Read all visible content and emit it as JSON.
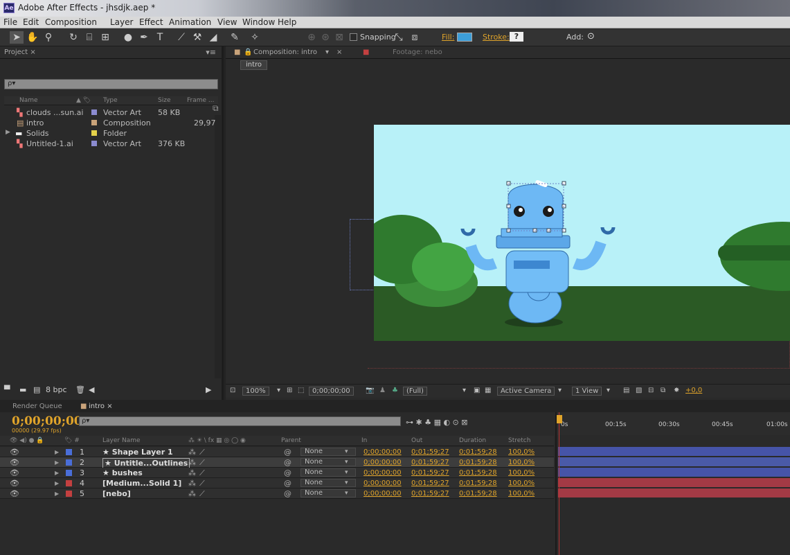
{
  "app": {
    "title": "Adobe After Effects - jhsdjk.aep *",
    "logo_text": "Ae"
  },
  "menu": [
    "File",
    "Edit",
    "Composition",
    "Layer",
    "Effect",
    "Animation",
    "View",
    "Window",
    "Help"
  ],
  "toolbar": {
    "snapping_label": "Snapping",
    "fill_label": "Fill:",
    "stroke_label": "Stroke:",
    "stroke_value": "?",
    "add_label": "Add:",
    "fill_color": "#3d9ed8",
    "snapping_checked": false
  },
  "project": {
    "tab_label": "Project ×",
    "search_placeholder": "ρ▾",
    "columns": [
      "Name",
      "Type",
      "Size",
      "Frame ..."
    ],
    "items": [
      {
        "name": "clouds ...sun.ai",
        "type": "Vector Art",
        "size": "58 KB",
        "frame": "",
        "color": "#8b8bd0",
        "icon": "vector-art-icon"
      },
      {
        "name": "intro",
        "type": "Composition",
        "size": "",
        "frame": "29,97",
        "color": "#c9a37a",
        "icon": "composition-icon"
      },
      {
        "name": "Solids",
        "type": "Folder",
        "size": "",
        "frame": "",
        "color": "#e4d14a",
        "icon": "folder-icon"
      },
      {
        "name": "Untitled-1.ai",
        "type": "Vector Art",
        "size": "376 KB",
        "frame": "",
        "color": "#8b8bd0",
        "icon": "vector-art-icon"
      }
    ],
    "bpc": "8 bpc"
  },
  "composition": {
    "tab_label": "Composition: intro",
    "footage_tab": "Footage: nebo",
    "breadcrumb": "intro",
    "zoom": "100%",
    "timecode": "0;00;00;00",
    "resolution": "(Full)",
    "camera": "Active Camera",
    "view": "1 View",
    "exposure": "+0,0"
  },
  "timeline": {
    "tabs": [
      "Render Queue",
      "intro ×"
    ],
    "timecode": "0;00;00;00",
    "fps": "00000 (29.97 fps)",
    "search_placeholder": "ρ▾",
    "columns": [
      "Layer Name",
      "Parent",
      "In",
      "Out",
      "Duration",
      "Stretch"
    ],
    "ruler": [
      "0s",
      "00:15s",
      "00:30s",
      "00:45s",
      "01:00s"
    ],
    "layers": [
      {
        "num": "1",
        "name": "★ Shape Layer 1",
        "label_color": "#4a6ed8",
        "parent": "None",
        "in": "0;00;00;00",
        "out": "0;01;59;27",
        "duration": "0;01;59;28",
        "stretch": "100,0%",
        "selected": false,
        "bar_color": "#4654a8"
      },
      {
        "num": "2",
        "name": "★ Untitle...Outlines",
        "label_color": "#4a6ed8",
        "parent": "None",
        "in": "0;00;00;00",
        "out": "0;01;59;27",
        "duration": "0;01;59;28",
        "stretch": "100,0%",
        "selected": true,
        "bar_color": "#4a5aa8"
      },
      {
        "num": "3",
        "name": "★ bushes",
        "label_color": "#4a6ed8",
        "parent": "None",
        "in": "0;00;00;00",
        "out": "0;01;59;27",
        "duration": "0;01;59;28",
        "stretch": "100,0%",
        "selected": false,
        "bar_color": "#4654a8"
      },
      {
        "num": "4",
        "name": "[Medium...Solid 1]",
        "label_color": "#c34040",
        "parent": "None",
        "in": "0;00;00;00",
        "out": "0;01;59;27",
        "duration": "0;01;59;28",
        "stretch": "100,0%",
        "selected": false,
        "bar_color": "#a33a45"
      },
      {
        "num": "5",
        "name": "[nebo]",
        "label_color": "#c34040",
        "parent": "None",
        "in": "0;00;00;00",
        "out": "0;01;59;27",
        "duration": "0;01;59;28",
        "stretch": "100,0%",
        "selected": false,
        "bar_color": "#a33a45"
      }
    ]
  }
}
